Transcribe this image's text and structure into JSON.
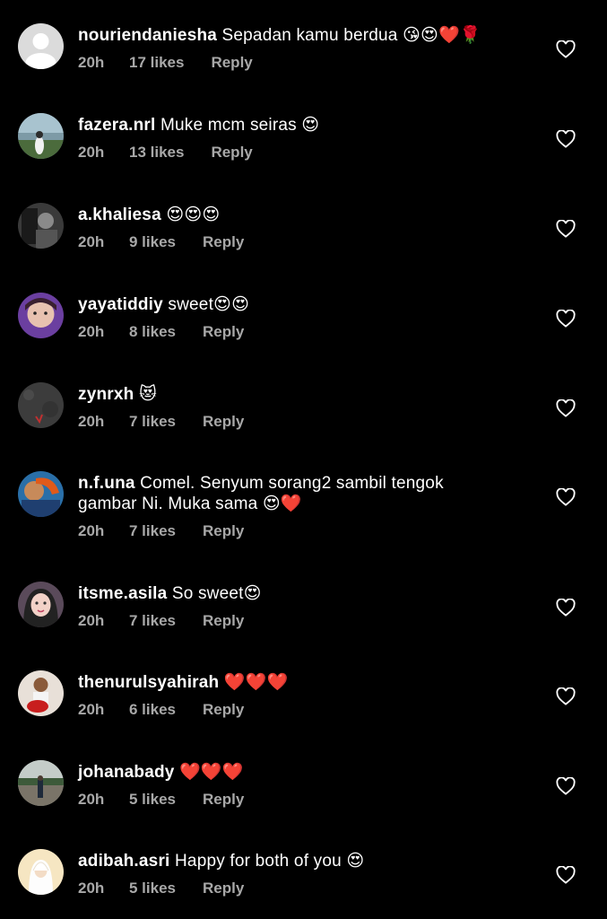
{
  "comments": [
    {
      "username": "nouriendaniesha",
      "text": "Sepadan kamu berdua 😘😍❤️🌹",
      "time": "20h",
      "likes": "17 likes",
      "reply": "Reply",
      "avatar": "default-avatar"
    },
    {
      "username": "fazera.nrl",
      "text": "Muke mcm seiras 😍",
      "time": "20h",
      "likes": "13 likes",
      "reply": "Reply",
      "avatar": "photo-avatar"
    },
    {
      "username": "a.khaliesa",
      "text": "😍😍😍",
      "time": "20h",
      "likes": "9 likes",
      "reply": "Reply",
      "avatar": "photo-avatar"
    },
    {
      "username": "yayatiddiy",
      "text": "sweet😍😍",
      "time": "20h",
      "likes": "8 likes",
      "reply": "Reply",
      "avatar": "photo-avatar"
    },
    {
      "username": "zynrxh",
      "text": "😻",
      "time": "20h",
      "likes": "7 likes",
      "reply": "Reply",
      "avatar": "photo-avatar"
    },
    {
      "username": "n.f.una",
      "text": "Comel. Senyum sorang2 sambil tengok gambar Ni. Muka sama 😍❤️",
      "time": "20h",
      "likes": "7 likes",
      "reply": "Reply",
      "avatar": "photo-avatar"
    },
    {
      "username": "itsme.asila",
      "text": "So sweet😍",
      "time": "20h",
      "likes": "7 likes",
      "reply": "Reply",
      "avatar": "photo-avatar"
    },
    {
      "username": "thenurulsyahirah",
      "text": "❤️❤️❤️",
      "time": "20h",
      "likes": "6 likes",
      "reply": "Reply",
      "avatar": "photo-avatar"
    },
    {
      "username": "johanabady",
      "text": "❤️❤️❤️",
      "time": "20h",
      "likes": "5 likes",
      "reply": "Reply",
      "avatar": "photo-avatar"
    },
    {
      "username": "adibah.asri",
      "text": "Happy for both of you 😍",
      "time": "20h",
      "likes": "5 likes",
      "reply": "Reply",
      "avatar": "photo-avatar"
    }
  ],
  "icons": {
    "like": "heart-outline-icon"
  },
  "colors": {
    "background": "#000000",
    "text": "#ffffff",
    "meta": "#a8a8a8"
  }
}
